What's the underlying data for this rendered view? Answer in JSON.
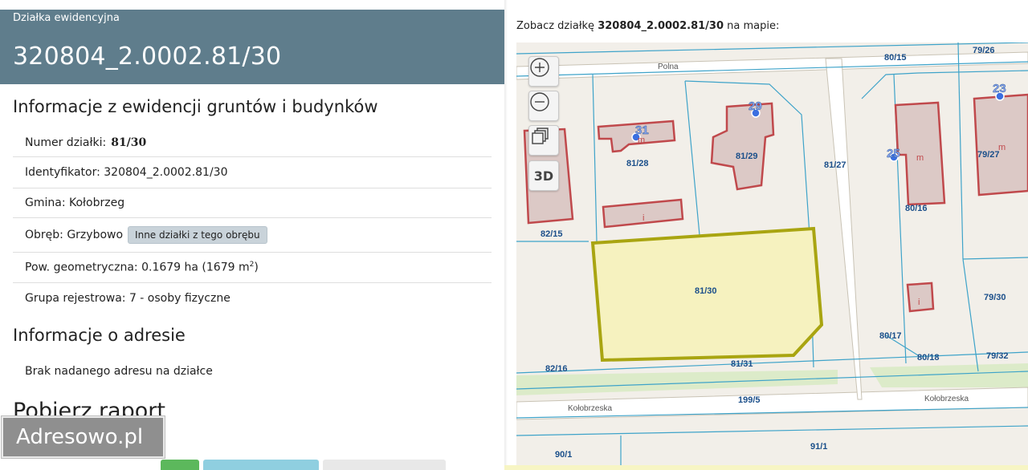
{
  "header": {
    "kicker": "Działka ewidencyjna",
    "title": "320804_2.0002.81/30"
  },
  "sections": {
    "egib_title": "Informacje z ewidencji gruntów i budynków",
    "address_title": "Informacje o adresie",
    "report_title": "Pobierz raport"
  },
  "details": {
    "numer_label": "Numer działki:",
    "numer_value": "81/30",
    "identyfikator": "Identyfikator: 320804_2.0002.81/30",
    "gmina": "Gmina: Kołobrzeg",
    "obreb_label": "Obręb: Grzybowo",
    "obreb_button": "Inne działki z tego obrębu",
    "pow_prefix": "Pow. geometryczna: 0.1679 ha (1679 m",
    "pow_sup": "2",
    "pow_suffix": ")",
    "grupa": "Grupa rejestrowa: 7 - osoby fizyczne"
  },
  "address": {
    "text": "Brak nadanego adresu na działce"
  },
  "logo": {
    "text": "Adresowo.pl"
  },
  "map": {
    "caption_prefix": "Zobacz działkę",
    "caption_parcel": "320804_2.0002.81/30",
    "caption_suffix": "na mapie:",
    "controls": {
      "zoom_in_icon": "plus-circle-icon",
      "zoom_out_icon": "minus-circle-icon",
      "layers_icon": "layers-icon",
      "view3d_label": "3D"
    },
    "streets": [
      "Polna",
      "Kołobrzeska",
      "Kołobrzeska"
    ],
    "parcel_labels": [
      "80/15",
      "79/26",
      "81/28",
      "81/29",
      "81/27",
      "82/15",
      "80/16",
      "79/27",
      "81/30",
      "79/30",
      "80/17",
      "80/18",
      "79/32",
      "82/16",
      "81/31",
      "199/5",
      "90/1",
      "91/1"
    ],
    "address_points": [
      "31",
      "29",
      "25",
      "23"
    ],
    "building_labels": [
      "m",
      "m",
      "m",
      "i",
      "i"
    ],
    "colors": {
      "selected_fill": "#f6f2bf",
      "selected_stroke": "#a9a511",
      "building_fill": "#dcc9c6",
      "building_stroke": "#c0494c",
      "parcel_line": "#3ea3c9",
      "label_color": "#1b4f8a",
      "point_color": "#3b6fe0"
    }
  }
}
